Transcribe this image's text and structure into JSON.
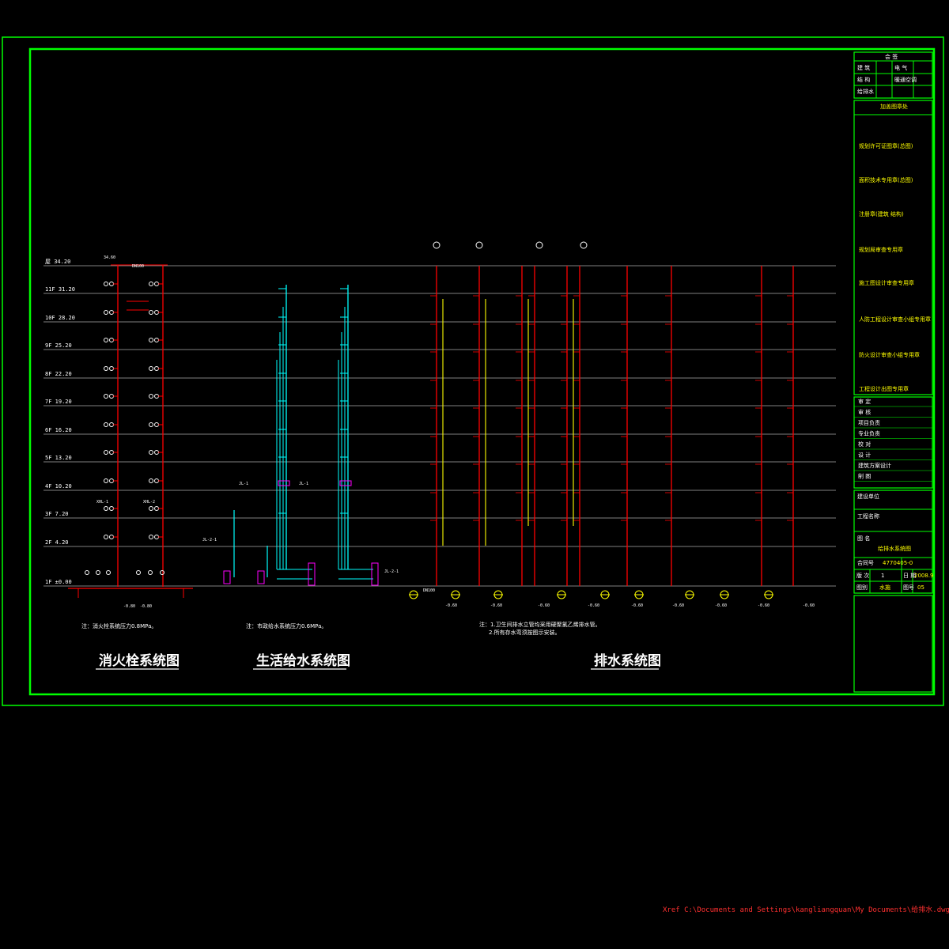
{
  "floors": [
    {
      "label": "屋 34.20"
    },
    {
      "label": "11F 31.20"
    },
    {
      "label": "10F 28.20"
    },
    {
      "label": "9F 25.20"
    },
    {
      "label": "8F 22.20"
    },
    {
      "label": "7F 19.20"
    },
    {
      "label": "6F 16.20"
    },
    {
      "label": "5F 13.20"
    },
    {
      "label": "4F 10.20"
    },
    {
      "label": "3F 7.20"
    },
    {
      "label": "2F 4.20"
    },
    {
      "label": "1F ±0.00"
    }
  ],
  "fire": {
    "roof_elev": "34.60",
    "riser_labels": [
      "XHL-1",
      "XHL-2"
    ],
    "pipe_size": "DN100",
    "sub_elev": [
      "-0.80",
      "-0.80"
    ],
    "note": "注：消火栓系统压力0.8MPa。",
    "title": "消火栓系统图"
  },
  "supply": {
    "riser_labels": [
      "JL-1",
      "JL-1",
      "JL-2-1",
      "JL-2-1"
    ],
    "note": "注：市政给水系统压力0.6MPa。",
    "title": "生活给水系统图"
  },
  "drain": {
    "elev_values": [
      "-0.60",
      "-0.60",
      "-0.60",
      "-0.60",
      "-0.60",
      "-0.60",
      "-0.60",
      "-0.60",
      "-0.60"
    ],
    "pipe_size": "DN100",
    "note_1": "注：1.卫生间排水立管均采用硬聚氯乙烯排水管。",
    "note_2": "2.所有存水弯须按图示安装。",
    "title": "排水系统图"
  },
  "title_block": {
    "sign_rows": [
      {
        "left": "建 筑",
        "right": "电 气"
      },
      {
        "left": "结 构",
        "right": "暖通空调"
      },
      {
        "left": "给排水",
        "right": ""
      }
    ],
    "sign_header": "会 签",
    "stamp_header": "加盖图章处",
    "stamp_rows": [
      "规划许可证图章(总图)",
      "面积技术专用章(总图)",
      "注册章(建筑  结构)",
      "规划局审查专用章",
      "施工图设计审查专用章",
      "人防工程设计审查小组专用章",
      "防火设计审查小组专用章",
      "工程设计出图专用章"
    ],
    "role_rows": [
      "审 定",
      "审 核",
      "项目负责",
      "专业负责",
      "校 对",
      "设 计",
      "建筑方案设计",
      "制 图"
    ],
    "project_rows": [
      {
        "label": "建设单位",
        "value": ""
      },
      {
        "label": "工程名称",
        "value": ""
      },
      {
        "label": "图 名",
        "value": "给排水系统图"
      }
    ],
    "contract_label": "合同号",
    "contract_value": "4770405-0",
    "version_label": "版 次",
    "version_value": "1",
    "date_label": "日 期",
    "date_value": "2008.9",
    "sheet_label": "图别",
    "sheet_value": "水施",
    "number_label": "图号",
    "number_value": "05"
  },
  "xref": "Xref C:\\Documents and Settings\\kangliangquan\\My Documents\\给排水.dwg",
  "colors": {
    "frame": "#00ff00",
    "fire_pipe": "#ff0000",
    "supply_pipe": "#00ffff",
    "drain_pipe": "#ff0000",
    "vent_pipe": "#ffff00",
    "floor_line": "#ffffff",
    "fittings": "#ff00ff"
  }
}
